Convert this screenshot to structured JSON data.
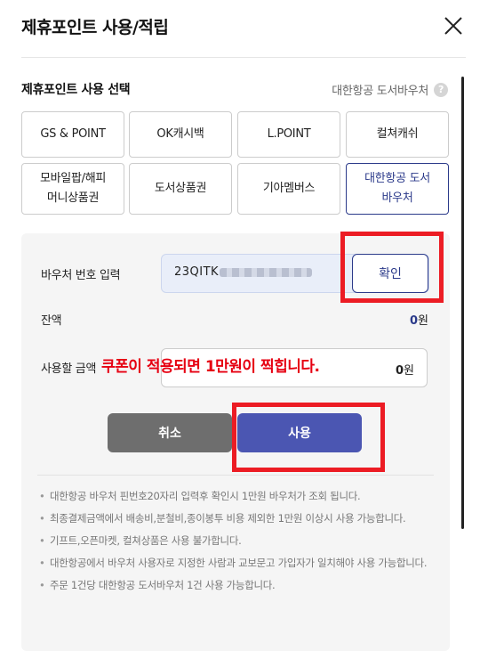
{
  "header": {
    "title": "제휴포인트 사용/적립",
    "close_label": "닫기"
  },
  "section": {
    "title": "제휴포인트 사용 선택",
    "hint": "대한항공 도서바우처",
    "help_symbol": "?"
  },
  "options": [
    {
      "label": "GS & POINT",
      "selected": false
    },
    {
      "label": "OK캐시백",
      "selected": false
    },
    {
      "label": "L.POINT",
      "selected": false
    },
    {
      "label": "컬쳐캐쉬",
      "selected": false
    },
    {
      "label": "모바일팝/해피\n머니상품권",
      "selected": false
    },
    {
      "label": "도서상품권",
      "selected": false
    },
    {
      "label": "기아멤버스",
      "selected": false
    },
    {
      "label": "대한항공 도서\n바우처",
      "selected": true
    }
  ],
  "form": {
    "voucher_label": "바우처 번호 입력",
    "voucher_value": "23QITK",
    "confirm_label": "확인",
    "balance_label": "잔액",
    "balance_value": "0",
    "balance_unit": "원",
    "use_label": "사용할 금액",
    "use_value": "0",
    "use_unit": "원",
    "cancel_label": "취소",
    "apply_label": "사용"
  },
  "annotation": {
    "text": "쿠폰이 적용되면 1만원이 찍힙니다.",
    "color": "#e60012"
  },
  "notes": [
    "대한항공 바우처 핀번호20자리 입력후 확인시 1만원 바우처가 조회 됩니다.",
    "최종결제금액에서 배송비,분철비,종이봉투 비용 제외한 1만원 이상시 사용 가능합니다.",
    "기프트,오픈마켓, 컬쳐상품은 사용 불가합니다.",
    "대한항공에서 바우처 사용자로 지정한 사람과 교보문고 가입자가 일치해야 사용 가능합니다.",
    "주문 1건당 대한항공 도서바우처 1건 사용 가능합니다."
  ],
  "colors": {
    "accent": "#2b3a8a",
    "apply_button": "#4b56b2",
    "cancel_button": "#6e6e6e",
    "highlight": "#ec1c24"
  }
}
